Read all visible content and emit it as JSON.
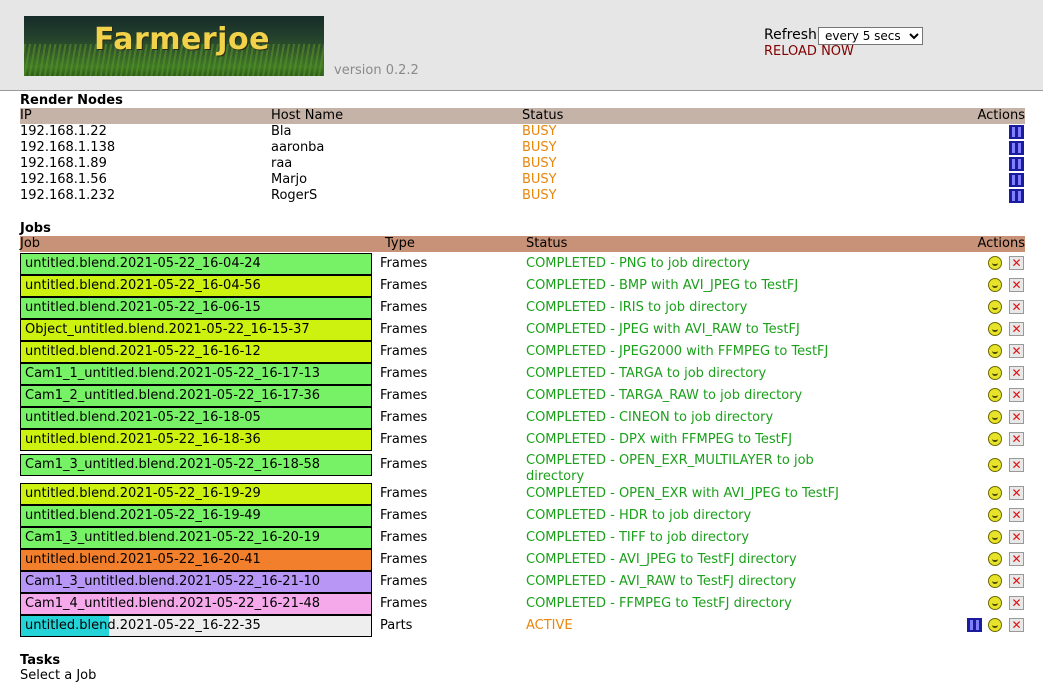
{
  "header": {
    "logo_text": "Farmerjoe",
    "version": "version 0.2.2",
    "refresh_label": "Refresh",
    "refresh_selected": "every 5 secs",
    "reload_label": "RELOAD NOW"
  },
  "nodes": {
    "title": "Render Nodes",
    "columns": {
      "ip": "IP",
      "host": "Host Name",
      "status": "Status",
      "actions": "Actions"
    },
    "rows": [
      {
        "ip": "192.168.1.22",
        "host": "Bla",
        "status": "BUSY"
      },
      {
        "ip": "192.168.1.138",
        "host": "aaronba",
        "status": "BUSY"
      },
      {
        "ip": "192.168.1.89",
        "host": "raa",
        "status": "BUSY"
      },
      {
        "ip": "192.168.1.56",
        "host": "Marjo",
        "status": "BUSY"
      },
      {
        "ip": "192.168.1.232",
        "host": "RogerS",
        "status": "BUSY"
      }
    ]
  },
  "jobs": {
    "title": "Jobs",
    "columns": {
      "job": "Job",
      "type": "Type",
      "status": "Status",
      "actions": "Actions"
    },
    "rows": [
      {
        "name": "untitled.blend.2021-05-22_16-04-24",
        "type": "Frames",
        "status": "COMPLETED - PNG to job directory",
        "color": "#77f266"
      },
      {
        "name": "untitled.blend.2021-05-22_16-04-56",
        "type": "Frames",
        "status": "COMPLETED - BMP with AVI_JPEG to TestFJ",
        "color": "#cdf20f"
      },
      {
        "name": "untitled.blend.2021-05-22_16-06-15",
        "type": "Frames",
        "status": "COMPLETED - IRIS to job directory",
        "color": "#77f266"
      },
      {
        "name": "Object_untitled.blend.2021-05-22_16-15-37",
        "type": "Frames",
        "status": "COMPLETED - JPEG with AVI_RAW to TestFJ",
        "color": "#cdf20f"
      },
      {
        "name": "untitled.blend.2021-05-22_16-16-12",
        "type": "Frames",
        "status": "COMPLETED - JPEG2000 with FFMPEG to TestFJ",
        "color": "#cdf20f"
      },
      {
        "name": "Cam1_1_untitled.blend.2021-05-22_16-17-13",
        "type": "Frames",
        "status": "COMPLETED - TARGA to job directory",
        "color": "#77f266"
      },
      {
        "name": "Cam1_2_untitled.blend.2021-05-22_16-17-36",
        "type": "Frames",
        "status": "COMPLETED - TARGA_RAW to job directory",
        "color": "#77f266"
      },
      {
        "name": "untitled.blend.2021-05-22_16-18-05",
        "type": "Frames",
        "status": "COMPLETED - CINEON to job directory",
        "color": "#77f266"
      },
      {
        "name": "untitled.blend.2021-05-22_16-18-36",
        "type": "Frames",
        "status": "COMPLETED - DPX with FFMPEG to TestFJ",
        "color": "#cdf20f"
      },
      {
        "name": "Cam1_3_untitled.blend.2021-05-22_16-18-58",
        "type": "Frames",
        "status": "COMPLETED - OPEN_EXR_MULTILAYER to job directory",
        "color": "#77f266"
      },
      {
        "name": "untitled.blend.2021-05-22_16-19-29",
        "type": "Frames",
        "status": "COMPLETED - OPEN_EXR with AVI_JPEG to TestFJ",
        "color": "#cdf20f"
      },
      {
        "name": "untitled.blend.2021-05-22_16-19-49",
        "type": "Frames",
        "status": "COMPLETED - HDR to job directory",
        "color": "#77f266"
      },
      {
        "name": "Cam1_3_untitled.blend.2021-05-22_16-20-19",
        "type": "Frames",
        "status": "COMPLETED - TIFF to job directory",
        "color": "#77f266"
      },
      {
        "name": "untitled.blend.2021-05-22_16-20-41",
        "type": "Frames",
        "status": "COMPLETED - AVI_JPEG to TestFJ directory",
        "color": "#f27f2b"
      },
      {
        "name": "Cam1_3_untitled.blend.2021-05-22_16-21-10",
        "type": "Frames",
        "status": "COMPLETED - AVI_RAW to TestFJ directory",
        "color": "#b896f5"
      },
      {
        "name": "Cam1_4_untitled.blend.2021-05-22_16-21-48",
        "type": "Frames",
        "status": "COMPLETED - FFMPEG to TestFJ directory",
        "color": "#f5a9ea"
      },
      {
        "name": "untitled.blend.2021-05-22_16-22-35",
        "type": "Parts",
        "status": "ACTIVE",
        "color": "#eeeeee",
        "progress": 0.25
      }
    ]
  },
  "tasks": {
    "title": "Tasks",
    "placeholder": "Select a Job"
  }
}
